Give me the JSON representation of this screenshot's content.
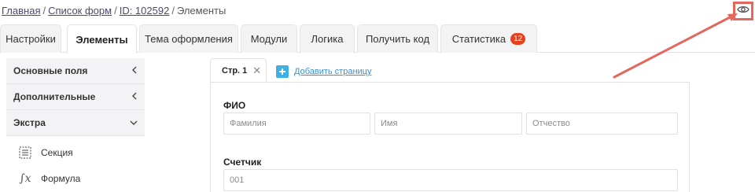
{
  "breadcrumb": {
    "home": "Главная",
    "forms": "Список форм",
    "form_id": "ID: 102592",
    "current": "Элементы",
    "separator": "/"
  },
  "tabs": [
    {
      "label": "Настройки"
    },
    {
      "label": "Элементы"
    },
    {
      "label": "Тема оформления"
    },
    {
      "label": "Модули"
    },
    {
      "label": "Логика"
    },
    {
      "label": "Получить код"
    },
    {
      "label": "Статистика",
      "badge": "12"
    }
  ],
  "active_tab": "Элементы",
  "sidebar": {
    "groups": [
      {
        "label": "Основные поля",
        "chevron": "chevron-left"
      },
      {
        "label": "Дополнительные",
        "chevron": "chevron-left"
      },
      {
        "label": "Экстра",
        "chevron": "chevron-down"
      }
    ],
    "items": [
      {
        "label": "Секция",
        "icon": "section-icon"
      },
      {
        "label": "Формула",
        "icon": "formula-icon"
      }
    ]
  },
  "page_tabs": {
    "page1": "Стр. 1",
    "add_page": "Добавить страницу"
  },
  "form": {
    "fio": {
      "label": "ФИО",
      "last_name_placeholder": "Фамилия",
      "first_name_placeholder": "Имя",
      "middle_name_placeholder": "Отчество"
    },
    "counter": {
      "label": "Счетчик",
      "placeholder": "001"
    }
  },
  "colors": {
    "highlight": "#e2685e",
    "badge": "#e8401c",
    "add_button": "#3fb0e6",
    "link": "#3a8fd4"
  }
}
